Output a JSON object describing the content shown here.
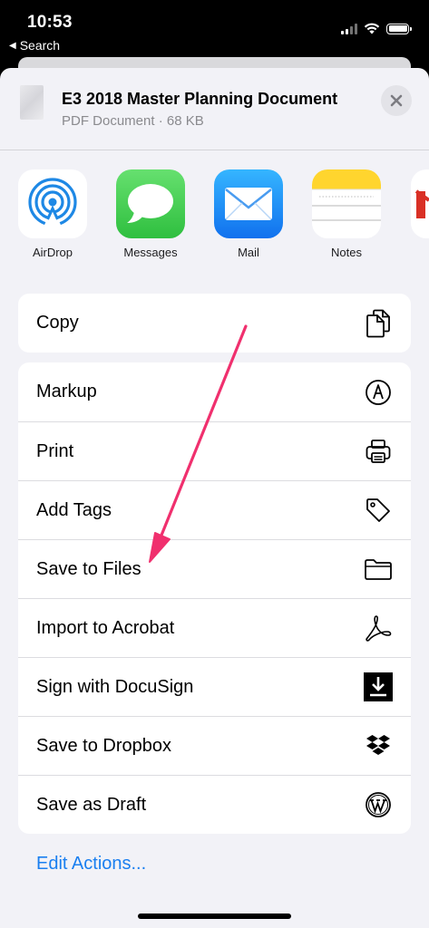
{
  "status_bar": {
    "time": "10:53",
    "back_label": "Search"
  },
  "share_header": {
    "title": "E3 2018 Master Planning Document",
    "subtitle": "PDF Document · 68 KB"
  },
  "apps": [
    {
      "label": "AirDrop"
    },
    {
      "label": "Messages"
    },
    {
      "label": "Mail"
    },
    {
      "label": "Notes"
    }
  ],
  "actions_group_1": [
    {
      "label": "Copy",
      "icon": "copy-icon"
    }
  ],
  "actions_group_2": [
    {
      "label": "Markup",
      "icon": "markup-icon"
    },
    {
      "label": "Print",
      "icon": "printer-icon"
    },
    {
      "label": "Add Tags",
      "icon": "tag-icon"
    },
    {
      "label": "Save to Files",
      "icon": "folder-icon"
    },
    {
      "label": "Import to Acrobat",
      "icon": "acrobat-icon"
    },
    {
      "label": "Sign with DocuSign",
      "icon": "docusign-icon"
    },
    {
      "label": "Save to Dropbox",
      "icon": "dropbox-icon"
    },
    {
      "label": "Save as Draft",
      "icon": "wordpress-icon"
    }
  ],
  "edit_actions_label": "Edit Actions...",
  "colors": {
    "accent": "#1a7ff0",
    "annotation_arrow": "#f0306e",
    "sheet_bg": "#f2f2f7"
  }
}
